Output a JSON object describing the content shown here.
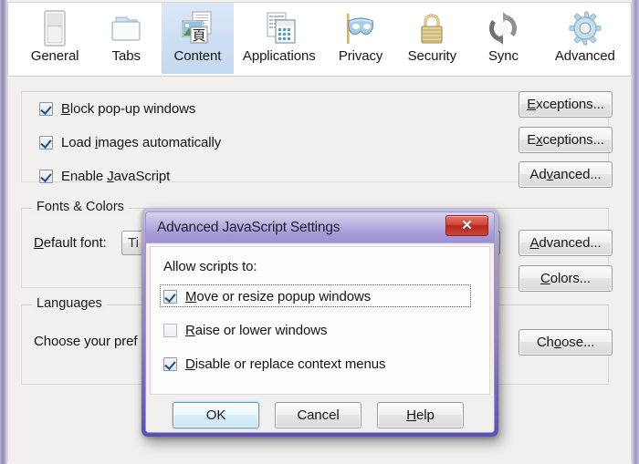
{
  "window": {
    "toolbar": {
      "tabs": [
        {
          "label": "General",
          "icon": "general-window-icon",
          "selected": false
        },
        {
          "label": "Tabs",
          "icon": "tabs-folder-icon",
          "selected": false
        },
        {
          "label": "Content",
          "icon": "content-page-icon",
          "selected": true
        },
        {
          "label": "Applications",
          "icon": "applications-icon",
          "selected": false
        },
        {
          "label": "Privacy",
          "icon": "privacy-mask-icon",
          "selected": false
        },
        {
          "label": "Security",
          "icon": "security-lock-icon",
          "selected": false
        },
        {
          "label": "Sync",
          "icon": "sync-arrows-icon",
          "selected": false
        },
        {
          "label": "Advanced",
          "icon": "advanced-gear-icon",
          "selected": false
        }
      ]
    },
    "content_pane": {
      "checkboxes": [
        {
          "label": "Block pop-up windows",
          "accesskey": "B",
          "checked": true
        },
        {
          "label": "Load images automatically",
          "accesskey": "i",
          "checked": true
        },
        {
          "label": "Enable JavaScript",
          "accesskey": "J",
          "checked": true
        }
      ],
      "side_buttons": [
        {
          "label": "Exceptions...",
          "accesskey": "E"
        },
        {
          "label": "Exceptions...",
          "accesskey": "x"
        },
        {
          "label": "Advanced...",
          "accesskey": "v"
        }
      ],
      "fonts_group": {
        "legend": "Fonts & Colors",
        "font_label": "Default font:",
        "font_label_accesskey": "D",
        "font_value": "Ti",
        "advanced_button": {
          "label": "Advanced...",
          "accesskey": "A"
        },
        "colors_button": {
          "label": "Colors...",
          "accesskey": "C"
        }
      },
      "languages_group": {
        "legend": "Languages",
        "description": "Choose your pref",
        "choose_button": {
          "label": "Choose...",
          "accesskey": "o"
        }
      }
    }
  },
  "dialog": {
    "title": "Advanced JavaScript Settings",
    "close_icon": "close-icon",
    "close_glyph": "✕",
    "heading": "Allow scripts to:",
    "options": [
      {
        "label": "Move or resize popup windows",
        "accesskey": "M",
        "checked": true,
        "focused": true
      },
      {
        "label": "Raise or lower windows",
        "accesskey": "R",
        "checked": false,
        "focused": false
      },
      {
        "label": "Disable or replace context menus",
        "accesskey": "D",
        "checked": true,
        "focused": false
      }
    ],
    "buttons": [
      {
        "label": "OK",
        "accesskey": "",
        "default": true
      },
      {
        "label": "Cancel",
        "accesskey": "",
        "default": false
      },
      {
        "label": "Help",
        "accesskey": "H",
        "default": false
      }
    ]
  },
  "colors": {
    "selected_tab_bg": "#cfe0f4",
    "dialog_border": "#6a5bbd",
    "close_button_red": "#c9463a",
    "default_button_blue": "#4ba3d3",
    "panel_bg": "#f1f0ef"
  }
}
